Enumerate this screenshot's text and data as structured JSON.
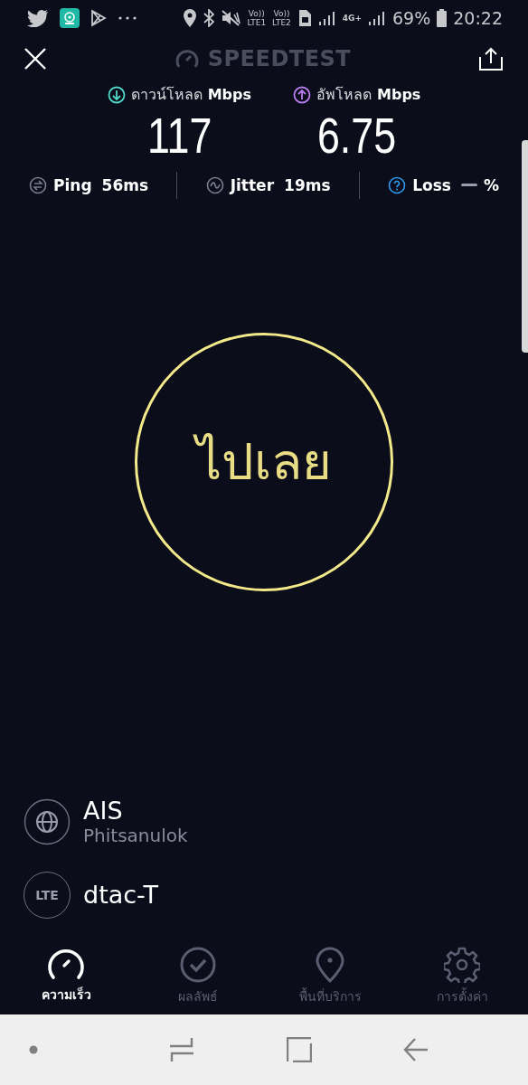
{
  "status_bar": {
    "signal_labels": [
      "Vo))",
      "LTE1",
      "Vo))",
      "LTE2",
      "4G+"
    ],
    "battery": "69%",
    "time": "20:22"
  },
  "header": {
    "title": "SPEEDTEST"
  },
  "results": [
    {
      "kind": "download",
      "label": "ดาวน์โหลด",
      "unit": "Mbps",
      "value": "117",
      "color": "#4fd8c8"
    },
    {
      "kind": "upload",
      "label": "อัพโหลด",
      "unit": "Mbps",
      "value": "6.75",
      "color": "#b77cf0"
    }
  ],
  "metrics": [
    {
      "kind": "ping",
      "label": "Ping",
      "value": "56ms"
    },
    {
      "kind": "jitter",
      "label": "Jitter",
      "value": "19ms"
    },
    {
      "kind": "loss",
      "label": "Loss",
      "value": "%"
    }
  ],
  "go_button": {
    "label": "ไปเลย"
  },
  "servers": [
    {
      "kind": "host",
      "name": "AIS",
      "location": "Phitsanulok"
    },
    {
      "kind": "carrier",
      "name": "dtac-T",
      "badge": "LTE"
    }
  ],
  "tabs": [
    {
      "kind": "speed",
      "label": "ความเร็ว",
      "selected": true
    },
    {
      "kind": "results",
      "label": "ผลลัพธ์",
      "selected": false
    },
    {
      "kind": "coverage",
      "label": "พื้นที่บริการ",
      "selected": false
    },
    {
      "kind": "settings",
      "label": "การตั้งค่า",
      "selected": false
    }
  ]
}
